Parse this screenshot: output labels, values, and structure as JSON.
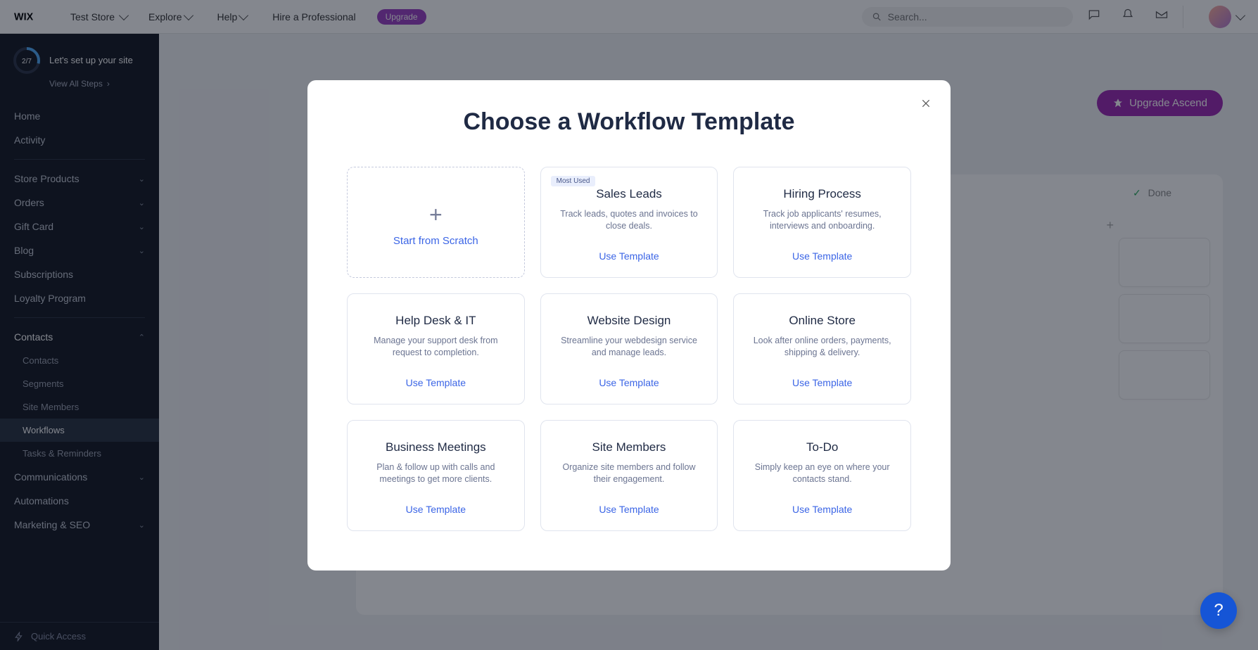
{
  "topbar": {
    "site_name": "Test Store",
    "explore": "Explore",
    "help": "Help",
    "hire": "Hire a Professional",
    "upgrade_badge": "Upgrade",
    "search_placeholder": "Search..."
  },
  "sidebar": {
    "setup_line": "Let's set up your site",
    "setup_progress": "2/7",
    "view_all": "View All Steps",
    "items": {
      "home": "Home",
      "activity": "Activity",
      "store_products": "Store Products",
      "orders": "Orders",
      "gift_card": "Gift Card",
      "blog": "Blog",
      "subscriptions": "Subscriptions",
      "loyalty": "Loyalty Program",
      "contacts": "Contacts",
      "contacts_sub": "Contacts",
      "segments": "Segments",
      "site_members": "Site Members",
      "workflows": "Workflows",
      "tasks": "Tasks & Reminders",
      "communications": "Communications",
      "automations": "Automations",
      "marketing": "Marketing & SEO"
    },
    "quick_access": "Quick Access"
  },
  "banner": {
    "upgrade_ascend": "Upgrade Ascend"
  },
  "kanban": {
    "done_col": "Done"
  },
  "modal": {
    "title": "Choose a Workflow Template",
    "scratch_label": "Start from Scratch",
    "most_used": "Most Used",
    "use_template": "Use Template",
    "templates": [
      {
        "title": "Sales Leads",
        "desc": "Track leads, quotes and invoices to close deals.",
        "most_used": true
      },
      {
        "title": "Hiring Process",
        "desc": "Track job applicants' resumes, interviews and onboarding."
      },
      {
        "title": "Help Desk & IT",
        "desc": "Manage your support desk from request to completion."
      },
      {
        "title": "Website Design",
        "desc": "Streamline your webdesign service and manage leads."
      },
      {
        "title": "Online Store",
        "desc": "Look after online orders, payments, shipping & delivery."
      },
      {
        "title": "Business Meetings",
        "desc": "Plan & follow up with calls and meetings to get more clients."
      },
      {
        "title": "Site Members",
        "desc": "Organize site members and follow their engagement."
      },
      {
        "title": "To-Do",
        "desc": "Simply keep an eye on where your contacts stand."
      }
    ]
  }
}
